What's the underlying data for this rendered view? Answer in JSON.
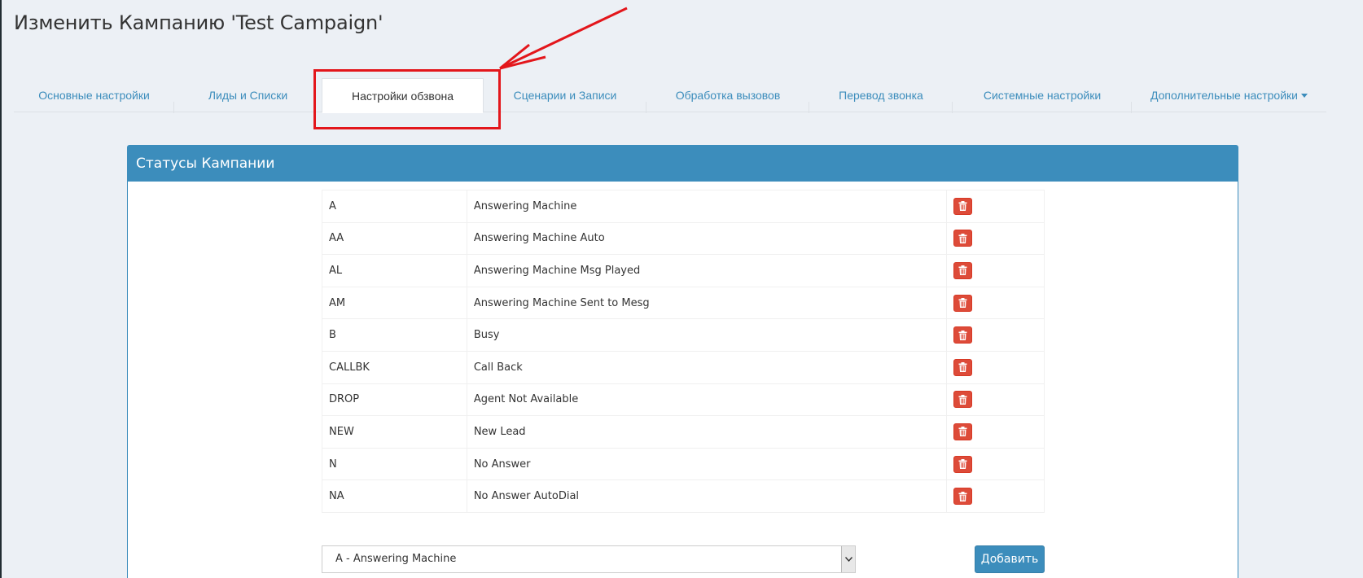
{
  "page": {
    "title": "Изменить Кампанию 'Test Campaign'"
  },
  "tabs": [
    {
      "label": "Основные настройки",
      "active": false
    },
    {
      "label": "Лиды и Списки",
      "active": false
    },
    {
      "label": "Настройки обзвона",
      "active": true
    },
    {
      "label": "Сценарии и Записи",
      "active": false
    },
    {
      "label": "Обработка вызовов",
      "active": false
    },
    {
      "label": "Перевод звонка",
      "active": false
    },
    {
      "label": "Системные настройки",
      "active": false
    },
    {
      "label": "Дополнительные настройки",
      "active": false,
      "dropdown": true
    }
  ],
  "panel": {
    "title": "Статусы Кампании",
    "statuses": [
      {
        "code": "A",
        "description": "Answering Machine"
      },
      {
        "code": "AA",
        "description": "Answering Machine Auto"
      },
      {
        "code": "AL",
        "description": "Answering Machine Msg Played"
      },
      {
        "code": "AM",
        "description": "Answering Machine Sent to Mesg"
      },
      {
        "code": "B",
        "description": "Busy"
      },
      {
        "code": "CALLBK",
        "description": "Call Back"
      },
      {
        "code": "DROP",
        "description": "Agent Not Available"
      },
      {
        "code": "NEW",
        "description": "New Lead"
      },
      {
        "code": "N",
        "description": "No Answer"
      },
      {
        "code": "NA",
        "description": "No Answer AutoDial"
      }
    ],
    "select_value": "A - Answering Machine",
    "add_label": "Добавить",
    "delete_icon": "trash-icon"
  },
  "colors": {
    "accent": "#3c8dbc",
    "danger": "#dd4b39",
    "annotation": "#e3161b",
    "background": "#ecf0f5"
  }
}
